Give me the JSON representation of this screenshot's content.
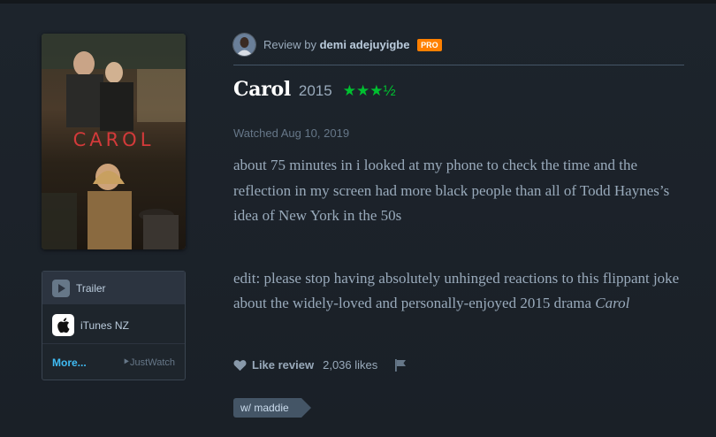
{
  "poster": {
    "title": "CAROL"
  },
  "watch": {
    "trailer_label": "Trailer",
    "service_label": "iTunes NZ",
    "more_label": "More...",
    "provider_label": "JustWatch"
  },
  "review": {
    "prefix": "Review by",
    "author": "demi adejuyigbe",
    "badge": "PRO",
    "film_title": "Carol",
    "year": "2015",
    "rating": "★★★½",
    "watched": "Watched Aug 10, 2019",
    "paragraph1": "about 75 minutes in i looked at my phone to check the time and the reflection in my screen had more black people than all of Todd Haynes’s idea of New York in the 50s",
    "paragraph2_text": "edit: please stop having absolutely unhinged reactions to this flippant joke about the widely-loved and personally-enjoyed 2015 drama ",
    "paragraph2_em": "Carol"
  },
  "actions": {
    "like_label": "Like review",
    "like_count": "2,036 likes"
  },
  "tags": [
    "w/ maddie"
  ],
  "colors": {
    "background": "#1d242c",
    "rating_green": "#00c030",
    "pro_orange": "#ff8000",
    "link_blue": "#40bcf4",
    "tag_bg": "#445566"
  },
  "icons": [
    "play-icon",
    "apple-icon",
    "heart-icon",
    "flag-icon"
  ]
}
